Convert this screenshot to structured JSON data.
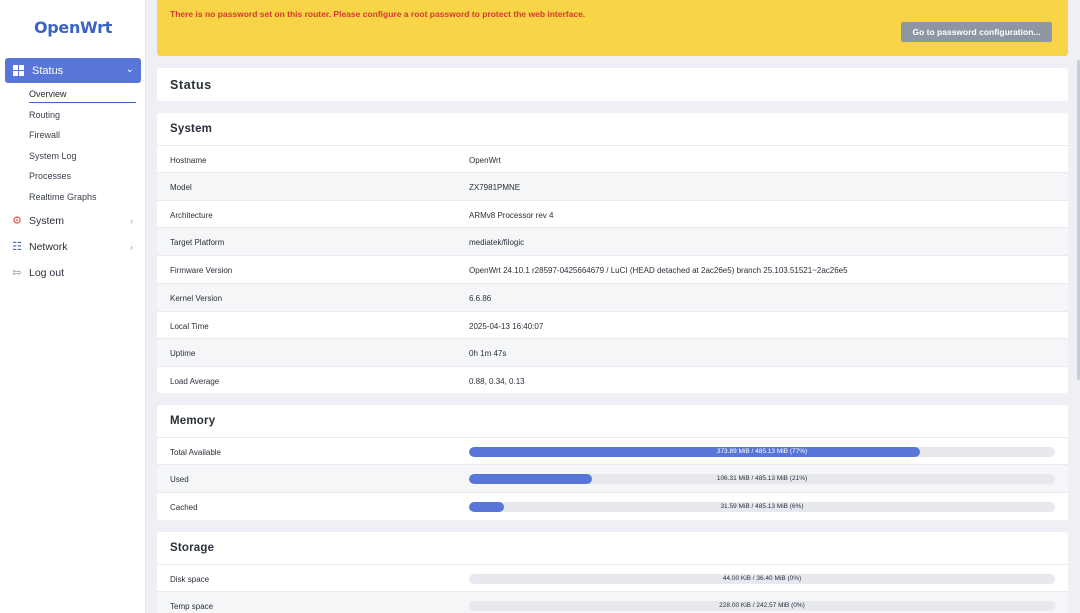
{
  "app": {
    "logo": "OpenWrt"
  },
  "sidebar": {
    "status": {
      "label": "Status",
      "icon": "dashboard-icon"
    },
    "status_items": [
      {
        "label": "Overview",
        "active": true
      },
      {
        "label": "Routing"
      },
      {
        "label": "Firewall"
      },
      {
        "label": "System Log"
      },
      {
        "label": "Processes"
      },
      {
        "label": "Realtime Graphs"
      }
    ],
    "menu": [
      {
        "label": "System",
        "icon": "gear-icon"
      },
      {
        "label": "Network",
        "icon": "network-icon"
      },
      {
        "label": "Log out",
        "icon": "logout-icon"
      }
    ]
  },
  "alert": {
    "message": "There is no password set on this router. Please configure a root password to protect the web interface.",
    "button": "Go to password configuration..."
  },
  "page": {
    "title": "Status"
  },
  "system": {
    "title": "System",
    "rows": [
      {
        "key": "Hostname",
        "value": "OpenWrt"
      },
      {
        "key": "Model",
        "value": "ZX7981PMNE"
      },
      {
        "key": "Architecture",
        "value": "ARMv8 Processor rev 4"
      },
      {
        "key": "Target Platform",
        "value": "mediatek/filogic"
      },
      {
        "key": "Firmware Version",
        "value": "OpenWrt 24.10.1 r28597-0425664679 / LuCI (HEAD detached at 2ac26e5) branch 25.103.51521~2ac26e5"
      },
      {
        "key": "Kernel Version",
        "value": "6.6.86"
      },
      {
        "key": "Local Time",
        "value": "2025-04-13 16:40:07"
      },
      {
        "key": "Uptime",
        "value": "0h 1m 47s"
      },
      {
        "key": "Load Average",
        "value": "0.88, 0.34, 0.13"
      }
    ]
  },
  "memory": {
    "title": "Memory",
    "rows": [
      {
        "key": "Total Available",
        "value": "373.89 MiB / 485.13 MiB (77%)",
        "percent": 77
      },
      {
        "key": "Used",
        "value": "106.31 MiB / 485.13 MiB (21%)",
        "percent": 21
      },
      {
        "key": "Cached",
        "value": "31.59 MiB / 485.13 MiB (6%)",
        "percent": 6
      }
    ]
  },
  "storage": {
    "title": "Storage",
    "rows": [
      {
        "key": "Disk space",
        "value": "44.00 KiB / 36.40 MiB (0%)",
        "percent": 0
      },
      {
        "key": "Temp space",
        "value": "228.00 KiB / 242.57 MiB (0%)",
        "percent": 0
      }
    ]
  },
  "colors": {
    "accent": "#5876d8",
    "alert_bg": "#f7d547",
    "alert_text": "#d23b2f",
    "button": "#8f96a3"
  }
}
